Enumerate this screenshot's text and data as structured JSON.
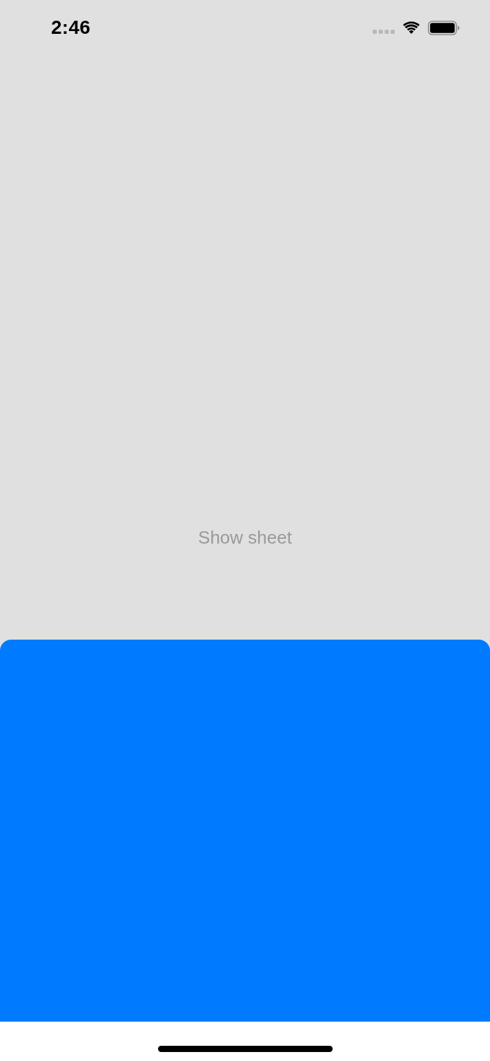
{
  "status_bar": {
    "time": "2:46"
  },
  "button": {
    "label": "Show sheet"
  },
  "sheet": {
    "presented": true
  }
}
